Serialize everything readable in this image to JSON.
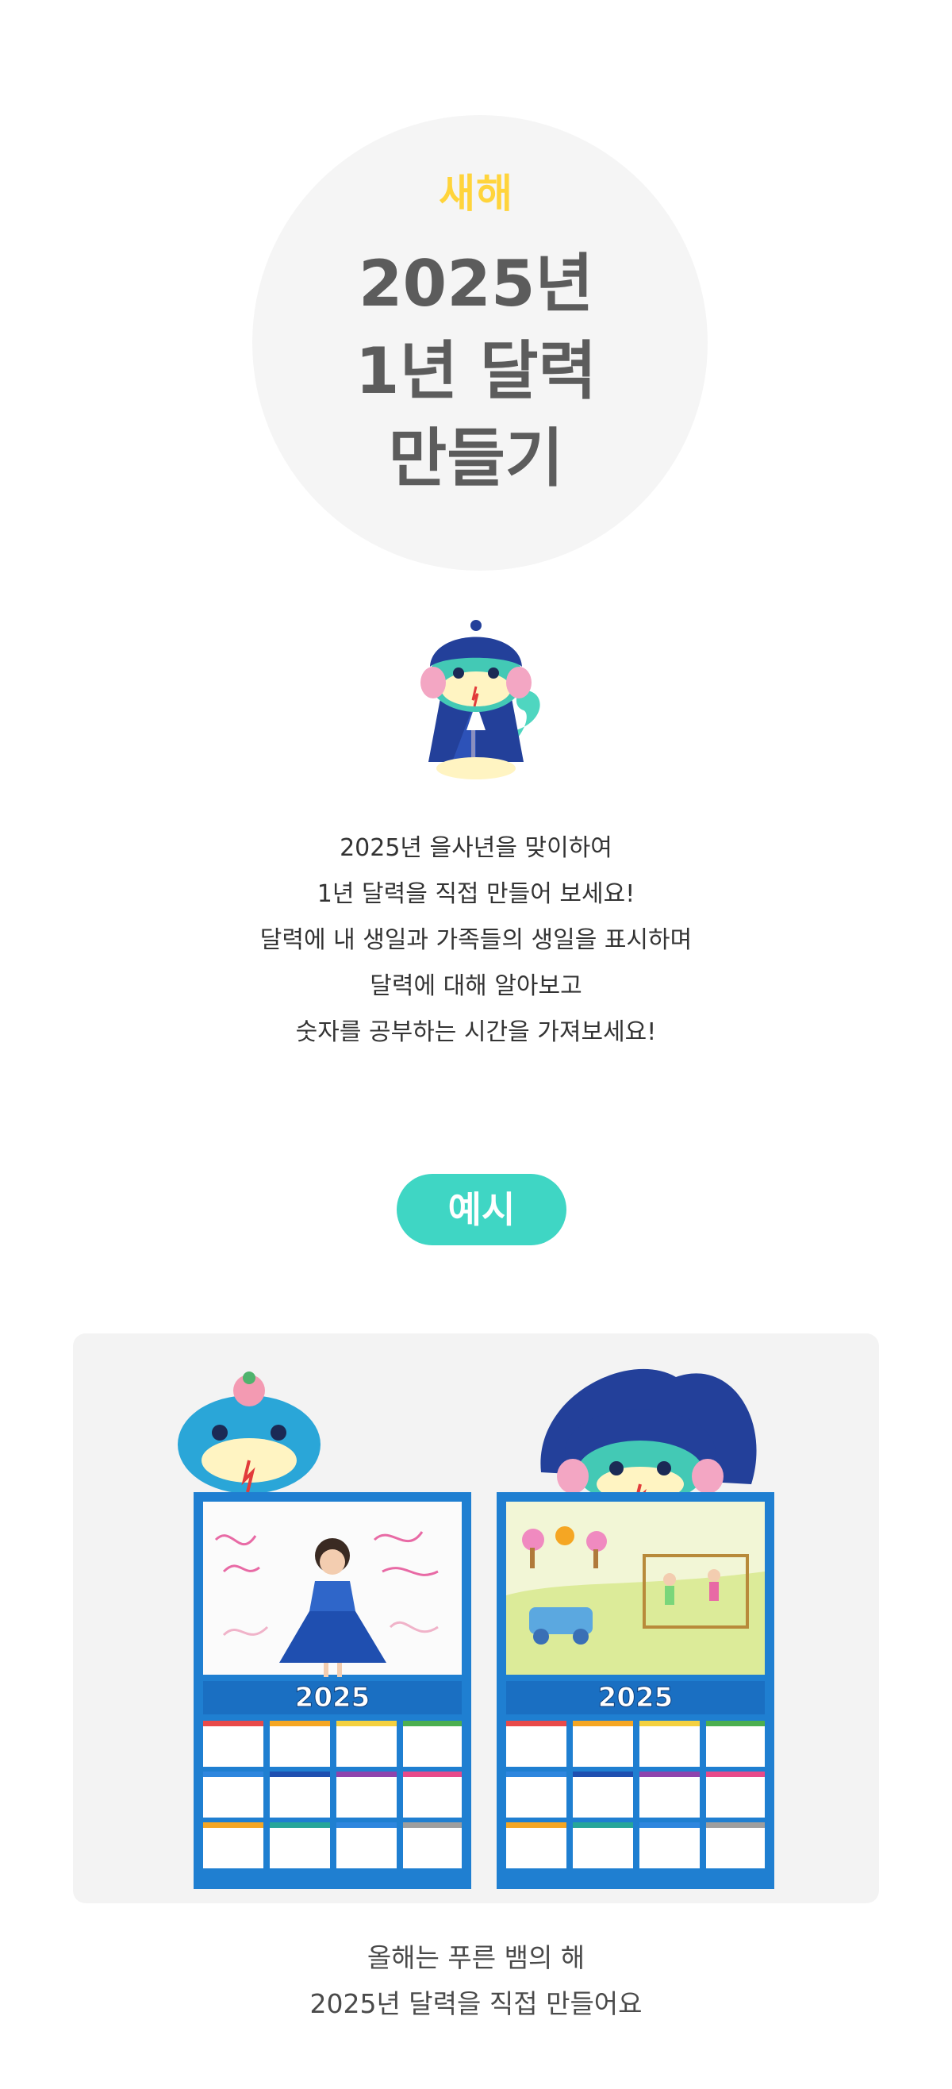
{
  "hero": {
    "kicker": "새해",
    "title_lines": [
      "2025년",
      "1년 달력",
      "만들기"
    ]
  },
  "intro": {
    "lines": [
      "2025년 을사년을 맞이하여",
      "1년 달력을 직접 만들어 보세요!",
      "달력에 내 생일과 가족들의 생일을 표시하며",
      "달력에 대해 알아보고",
      "숫자를 공부하는 시간을 가져보세요!"
    ]
  },
  "example": {
    "label": "예시",
    "calendars": [
      {
        "year_label": "2025",
        "picture": "girl-photo-with-crayon-drawing"
      },
      {
        "year_label": "2025",
        "picture": "child-crayon-drawing-car-and-family"
      }
    ]
  },
  "caption": {
    "lines": [
      "올해는 푸른 뱀의 해",
      "2025년 달력을 직접 만들어요"
    ]
  },
  "icons": {
    "mascot": "blue-snake-mascot-icon"
  },
  "colors": {
    "accent_yellow": "#ffd43b",
    "accent_teal": "#3fd6c4",
    "title_gray": "#5c5c5c",
    "calendar_blue": "#1f7fd1"
  }
}
